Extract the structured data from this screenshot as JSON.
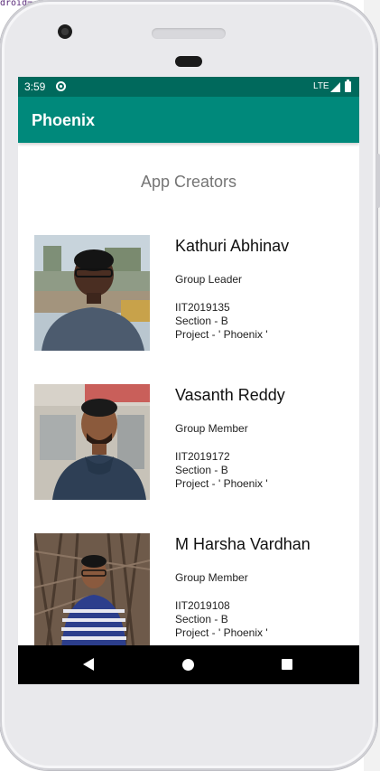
{
  "ide": {
    "code_snippet": "droid="
  },
  "status_bar": {
    "time": "3:59",
    "network": "LTE"
  },
  "app_bar": {
    "title": "Phoenix"
  },
  "page": {
    "heading": "App Creators"
  },
  "members": [
    {
      "name": "Kathuri Abhinav",
      "role": "Group Leader",
      "id": "IIT2019135",
      "section": "Section - B",
      "project": "Project - ' Phoenix '"
    },
    {
      "name": "Vasanth Reddy",
      "role": "Group Member",
      "id": "IIT2019172",
      "section": "Section - B",
      "project": "Project - ' Phoenix '"
    },
    {
      "name": "M Harsha Vardhan",
      "role": "Group Member",
      "id": "IIT2019108",
      "section": "Section - B",
      "project": "Project - ' Phoenix '"
    }
  ],
  "colors": {
    "status_bar": "#00695c",
    "app_bar": "#00897b",
    "nav_bar": "#000000"
  },
  "icons": {
    "sync": "sync-icon",
    "signal": "signal-icon",
    "battery": "battery-icon",
    "back": "back-icon",
    "home": "home-icon",
    "recents": "recents-icon"
  }
}
